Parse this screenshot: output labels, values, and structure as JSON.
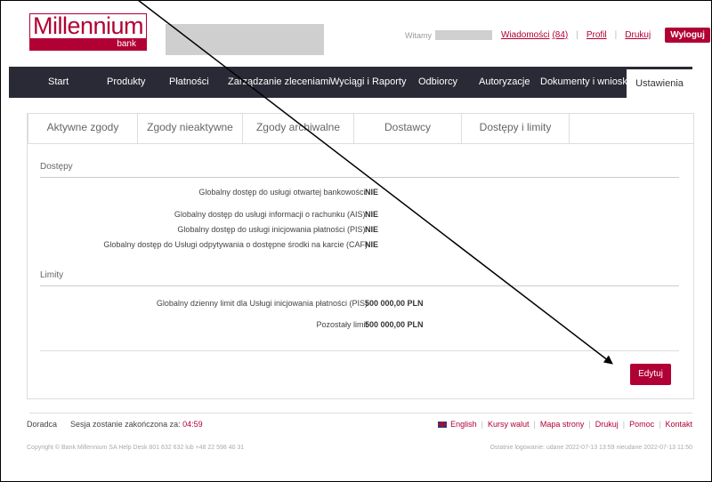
{
  "header": {
    "logo_text": "Millennium",
    "logo_sub": "bank",
    "welcome": "Witamy",
    "messages_label": "Wiadomości",
    "messages_count": "(84)",
    "profile": "Profil",
    "print": "Drukuj",
    "logout": "Wyloguj"
  },
  "nav": {
    "items": [
      "Start",
      "Produkty",
      "Płatności",
      "Zarządzanie zleceniami",
      "Wyciągi i Raporty",
      "Odbiorcy",
      "Autoryzacje",
      "Dokumenty i wnioski",
      "Ustawienia"
    ],
    "active": "Ustawienia"
  },
  "tabs": [
    "Aktywne zgody",
    "Zgody nieaktywne",
    "Zgody archiwalne",
    "Dostawcy",
    "Dostępy i limity"
  ],
  "access": {
    "title": "Dostępy",
    "rows": [
      {
        "label": "Globalny dostęp do usługi otwartej bankowości:",
        "value": "NIE"
      },
      {
        "label": "Globalny dostęp do usługi informacji o rachunku (AIS):",
        "value": "NIE"
      },
      {
        "label": "Globalny dostęp do usługi inicjowania płatności (PIS):",
        "value": "NIE"
      },
      {
        "label": "Globalny dostęp do Usługi odpytywania o dostępne środki na karcie (CAF)",
        "value": "NIE"
      }
    ]
  },
  "limits": {
    "title": "Limity",
    "rows": [
      {
        "label": "Globalny dzienny limit dla Usługi inicjowania płatności (PIS)",
        "value": "500 000,00 PLN"
      },
      {
        "label": "Pozostały limit",
        "value": "500 000,00 PLN"
      }
    ]
  },
  "edit_button": "Edytuj",
  "footer": {
    "advisor": "Doradca",
    "session_text": "Sesja zostanie zakończona za:",
    "session_timer": "04:59",
    "links": [
      "English",
      "Kursy walut",
      "Mapa strony",
      "Drukuj",
      "Pomoc",
      "Kontakt"
    ],
    "copyright": "Copyright © Bank Millennium SA    Help Desk 801 632 632 lub +48 22 598 40 31",
    "last_login": "Ostatnie logowanie: udane 2022-07-13 13:59    nieudane 2022-07-13 11:50"
  },
  "colors": {
    "brand": "#b10034",
    "nav_bg": "#2a2a36"
  }
}
